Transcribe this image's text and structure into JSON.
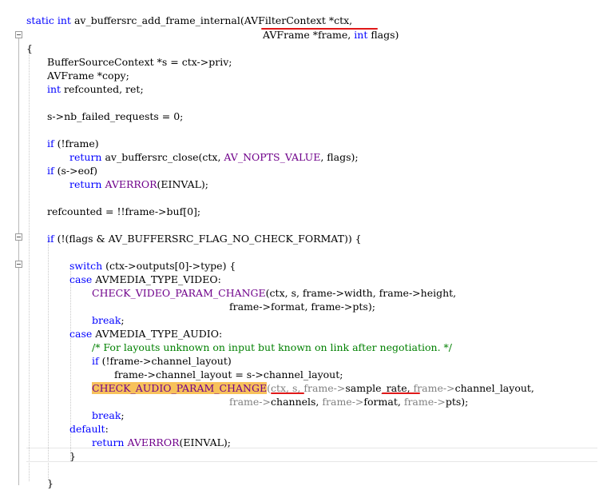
{
  "editor": {
    "lines": [
      {
        "segs": [
          {
            "t": "static int ",
            "c": "kw"
          },
          {
            "t": "av_buffersrc_add_frame_internal(AVFilterContext *ctx,",
            "c": ""
          }
        ]
      },
      {
        "segs": [
          {
            "t": "AVFrame *frame, ",
            "c": ""
          },
          {
            "t": "int",
            "c": "kw"
          },
          {
            "t": " flags)",
            "c": ""
          }
        ]
      },
      {
        "segs": [
          {
            "t": "{",
            "c": ""
          }
        ]
      },
      {
        "segs": [
          {
            "t": "BufferSourceContext *s = ctx->priv;",
            "c": ""
          }
        ]
      },
      {
        "segs": [
          {
            "t": "AVFrame *copy;",
            "c": ""
          }
        ]
      },
      {
        "segs": [
          {
            "t": "int",
            "c": "kw"
          },
          {
            "t": " refcounted, ret;",
            "c": ""
          }
        ]
      },
      {
        "segs": [
          {
            "t": "s->nb_failed_requests = 0;",
            "c": ""
          }
        ]
      },
      {
        "segs": [
          {
            "t": "if",
            "c": "kw"
          },
          {
            "t": " (!frame)",
            "c": ""
          }
        ]
      },
      {
        "segs": [
          {
            "t": "return",
            "c": "kw"
          },
          {
            "t": " av_buffersrc_close(ctx, ",
            "c": ""
          },
          {
            "t": "AV_NOPTS_VALUE",
            "c": "mac"
          },
          {
            "t": ", flags);",
            "c": ""
          }
        ]
      },
      {
        "segs": [
          {
            "t": "if",
            "c": "kw"
          },
          {
            "t": " (s->eof)",
            "c": ""
          }
        ]
      },
      {
        "segs": [
          {
            "t": "return",
            "c": "kw"
          },
          {
            "t": " ",
            "c": ""
          },
          {
            "t": "AVERROR",
            "c": "mac"
          },
          {
            "t": "(EINVAL);",
            "c": ""
          }
        ]
      },
      {
        "segs": [
          {
            "t": "refcounted = !!frame->buf[0];",
            "c": ""
          }
        ]
      },
      {
        "segs": [
          {
            "t": "if",
            "c": "kw"
          },
          {
            "t": " (!(flags & AV_BUFFERSRC_FLAG_NO_CHECK_FORMAT)) {",
            "c": ""
          }
        ]
      },
      {
        "segs": [
          {
            "t": "switch",
            "c": "kw"
          },
          {
            "t": " (ctx->outputs[0]->type) {",
            "c": ""
          }
        ]
      },
      {
        "segs": [
          {
            "t": "case",
            "c": "kw"
          },
          {
            "t": " AVMEDIA_TYPE_VIDEO:",
            "c": ""
          }
        ]
      },
      {
        "segs": [
          {
            "t": "CHECK_VIDEO_PARAM_CHANGE",
            "c": "mac"
          },
          {
            "t": "(ctx, s, frame->width, frame->height,",
            "c": ""
          }
        ]
      },
      {
        "segs": [
          {
            "t": "frame->format, frame->pts);",
            "c": ""
          }
        ]
      },
      {
        "segs": [
          {
            "t": "break",
            "c": "kw"
          },
          {
            "t": ";",
            "c": ""
          }
        ]
      },
      {
        "segs": [
          {
            "t": "case",
            "c": "kw"
          },
          {
            "t": " AVMEDIA_TYPE_AUDIO:",
            "c": ""
          }
        ]
      },
      {
        "segs": [
          {
            "t": "/* For layouts unknown on input but known on link after negotiation. */",
            "c": "cm"
          }
        ]
      },
      {
        "segs": [
          {
            "t": "if",
            "c": "kw"
          },
          {
            "t": " (!frame->channel_layout)",
            "c": ""
          }
        ]
      },
      {
        "segs": [
          {
            "t": "frame->channel_layout = s->channel_layout;",
            "c": ""
          }
        ]
      },
      {
        "segs": [
          {
            "t": "CHECK_AUDIO_PARAM_CHANGE",
            "c": "mac hl"
          },
          {
            "t": "(ctx, s, ",
            "c": "gr"
          },
          {
            "t": "frame->",
            "c": "gr"
          },
          {
            "t": "sample_rate, ",
            "c": ""
          },
          {
            "t": "frame->",
            "c": "gr"
          },
          {
            "t": "channel_layout,",
            "c": ""
          }
        ]
      },
      {
        "segs": [
          {
            "t": "frame->",
            "c": "gr"
          },
          {
            "t": "channels, ",
            "c": ""
          },
          {
            "t": "frame->",
            "c": "gr"
          },
          {
            "t": "format, ",
            "c": ""
          },
          {
            "t": "frame->",
            "c": "gr"
          },
          {
            "t": "pts);",
            "c": ""
          }
        ]
      },
      {
        "segs": [
          {
            "t": "break",
            "c": "kw"
          },
          {
            "t": ";",
            "c": ""
          }
        ]
      },
      {
        "segs": [
          {
            "t": "default",
            "c": "kw"
          },
          {
            "t": ":",
            "c": ""
          }
        ]
      },
      {
        "segs": [
          {
            "t": "return",
            "c": "kw"
          },
          {
            "t": " ",
            "c": ""
          },
          {
            "t": "AVERROR",
            "c": "mac"
          },
          {
            "t": "(EINVAL);",
            "c": ""
          }
        ]
      },
      {
        "segs": [
          {
            "t": "}",
            "c": ""
          }
        ]
      },
      {
        "segs": [
          {
            "t": "}",
            "c": ""
          }
        ]
      }
    ]
  }
}
